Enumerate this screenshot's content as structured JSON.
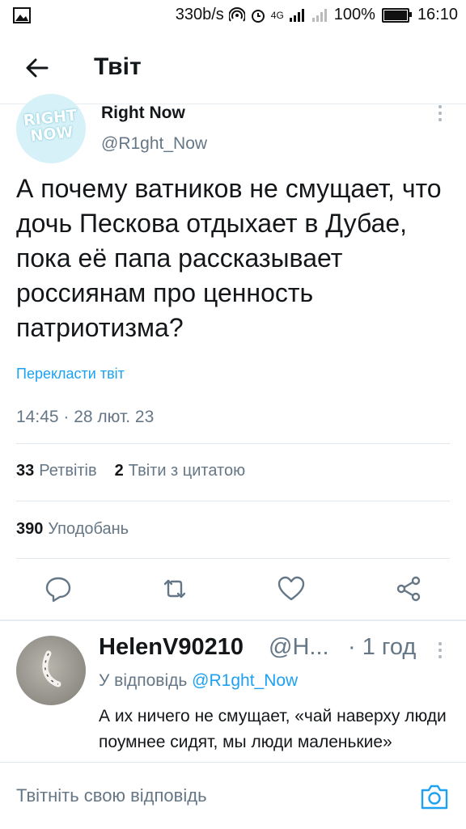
{
  "status_bar": {
    "speed": "330b/s",
    "network": "4G",
    "battery": "100%",
    "time": "16:10"
  },
  "header": {
    "title": "Твіт"
  },
  "tweet": {
    "author_name": "Right Now",
    "author_handle": "@R1ght_Now",
    "avatar_text": "RIGHT NOW",
    "text": "А почему ватников не смущает, что дочь Пескова отдыхает в Дубае, пока её папа рассказывает россиянам про ценность патриотизма?",
    "translate_label": "Перекласти твіт",
    "timestamp": "14:45 · 28 лют. 23",
    "retweets_count": "33",
    "retweets_label": "Ретвітів",
    "quotes_count": "2",
    "quotes_label": "Твіти з цитатою",
    "likes_count": "390",
    "likes_label": "Уподобань"
  },
  "reply": {
    "author_name": "HelenV90210",
    "author_handle": "@H...",
    "time": "· 1 год",
    "reply_to_prefix": "У відповідь",
    "reply_to_handle": "@R1ght_Now",
    "text": "А их ничего не смущает, «чай наверху люди поумнее сидят, мы люди маленькие»"
  },
  "composer": {
    "placeholder": "Твітніть свою відповідь"
  },
  "colors": {
    "accent": "#1da1f2",
    "secondary_text": "#657786",
    "primary_text": "#14171a",
    "divider": "#e1e8ed"
  }
}
